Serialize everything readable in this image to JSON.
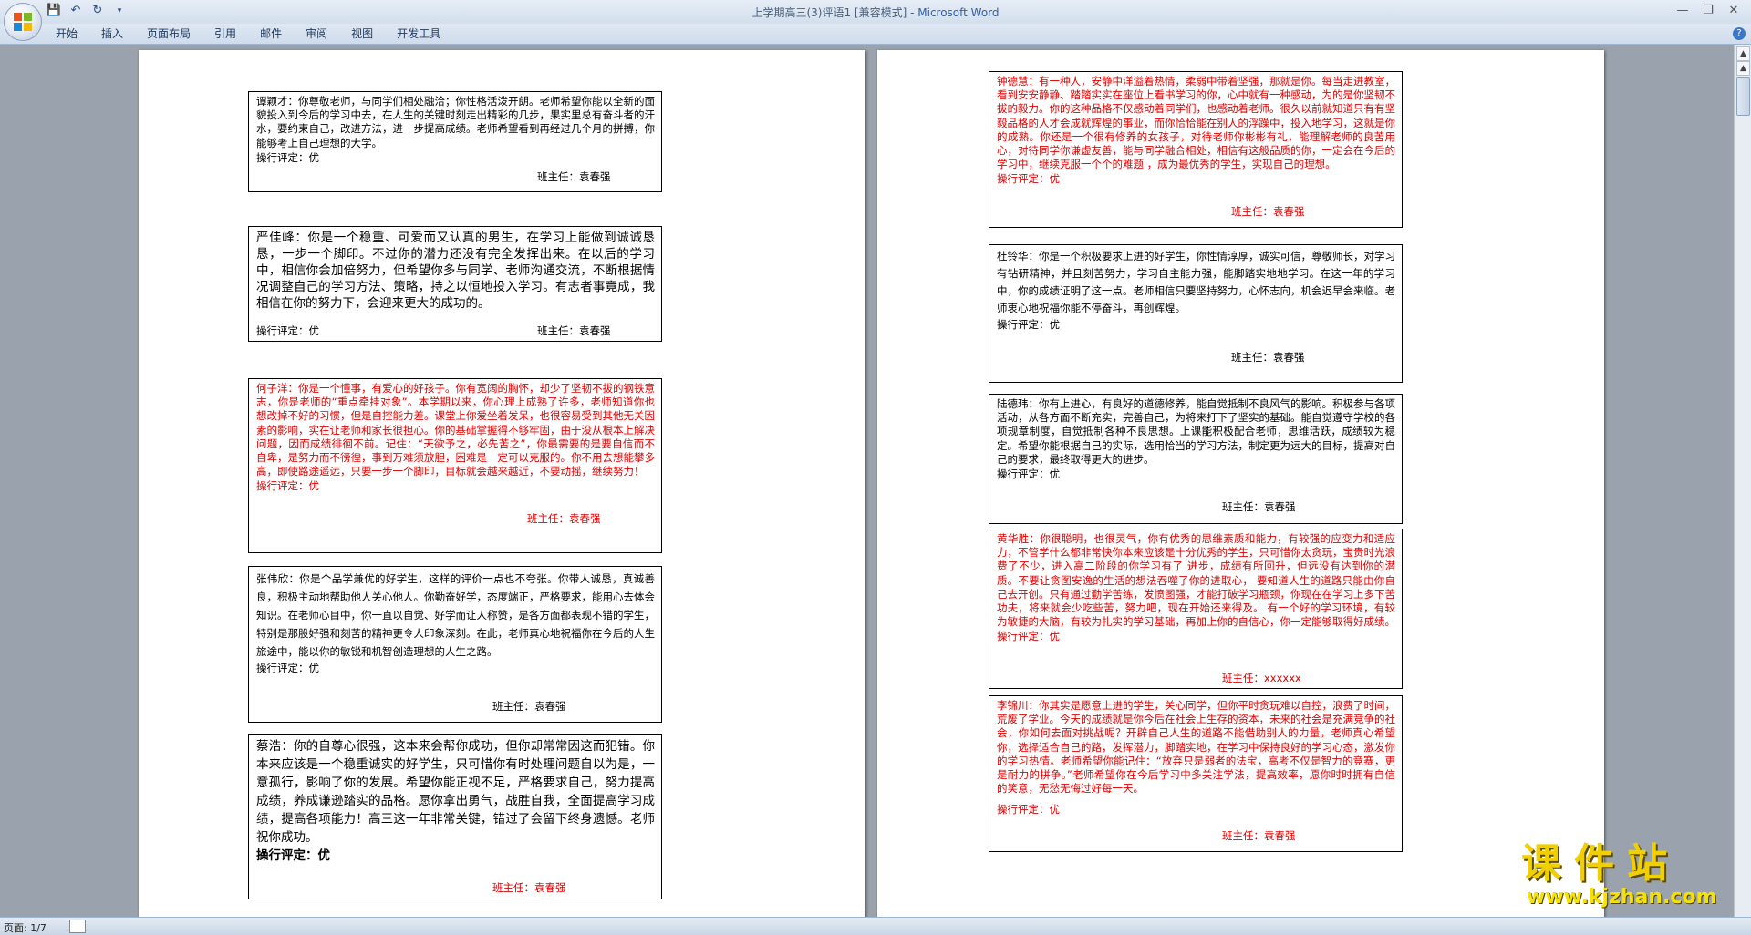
{
  "window": {
    "title": "上学期高三(3)评语1 [兼容模式]",
    "separator": " - ",
    "app": "Microsoft Word"
  },
  "ribbon": {
    "tabs": [
      "开始",
      "插入",
      "页面布局",
      "引用",
      "邮件",
      "审阅",
      "视图",
      "开发工具"
    ]
  },
  "rating_text": "操行评定：优",
  "teacher_label": "班主任：袁春强",
  "left_page": [
    {
      "name": "谭颖才",
      "text": "谭颖才：你尊敬老师，与同学们相处融洽；你性格活泼开朗。老师希望你能以全新的面貌投入到今后的学习中去，在人生的关键时刻走出精彩的几步，果实里总有奋斗者的汗水，要约束自己，改进方法，进一步提高成绩。老师希望看到再经过几个月的拼搏，你能够考上自己理想的大学。",
      "rating": "操行评定：优",
      "teacher": "班主任：袁春强",
      "color": "#000000"
    },
    {
      "name": "严佳峰",
      "text": "严佳峰：你是一个稳重、可爱而又认真的男生，在学习上能做到诚诚恳恳，一步一个脚印。不过你的潜力还没有完全发挥出来。在以后的学习中，相信你会加倍努力，但希望你多与同学、老师沟通交流，不断根据情况调整自己的学习方法、策略，持之以恒地投入学习。有志者事竟成，我相信在你的努力下，会迎来更大的成功的。",
      "rating": "操行评定：优",
      "teacher": "班主任：袁春强",
      "color": "#000000"
    },
    {
      "name": "何子洋",
      "text": "何子洋：你是一个懂事，有爱心的好孩子。你有宽阔的胸怀，却少了坚韧不拔的钢铁意志，你是老师的“重点牵挂对象”。本学期以来，你心理上成熟了许多，老师知道你也想改掉不好的习惯，但是自控能力差。课堂上你爱坐着发呆，也很容易受到其他无关因素的影响，实在让老师和家长很担心。你的基础掌握得不够牢固，由于没从根本上解决问题，因而成绩徘徊不前。记住：“天欲予之，必先苦之”，你最需要的是要自信而不自卑，是努力而不徬徨，事到万难须放胆，困难是一定可以克服的。你不用去想能攀多高，即使路途遥远，只要一步一个脚印，目标就会越来越近，不要动摇，继续努力！",
      "rating": "操行评定：优",
      "teacher": "班主任：袁春强",
      "color": "#e00000"
    },
    {
      "name": "张伟欣",
      "text": "张伟欣：你是个品学兼优的好学生，这样的评价一点也不夸张。你带人诚恳，真诚善良，积极主动地帮助他人关心他人。你勤奋好学，态度端正，严格要求，能用心去体会知识。在老师心目中，你一直以自觉、好学而让人称赞，是各方面都表现不错的学生，特别是那股好强和刻苦的精神更令人印象深刻。在此，老师真心地祝福你在今后的人生旅途中，能以你的敏锐和机智创造理想的人生之路。",
      "rating": "操行评定：优",
      "teacher": "班主任：袁春强",
      "color": "#000000"
    },
    {
      "name": "蔡浩",
      "text": "蔡浩：你的自尊心很强，这本来会帮你成功，但你却常常因这而犯错。你本来应该是一个稳重诚实的好学生，只可惜你有时处理问题自以为是，一意孤行，影响了你的发展。希望你能正视不足，严格要求自己，努力提高成绩，养成谦逊踏实的品格。愿你拿出勇气，战胜自我，全面提高学习成绩，提高各项能力！高三这一年非常关键，错过了会留下终身遗憾。老师祝你成功。",
      "rating": "操行评定：优",
      "teacher": "班主任：袁春强",
      "color": "#000000"
    }
  ],
  "right_page": [
    {
      "name": "钟德慧",
      "text": "钟德慧：有一种人，安静中洋溢着热情，柔弱中带着坚强，那就是你。每当走进教室，看到安安静静、踏踏实实在座位上看书学习的你，心中就有一种感动，为的是你坚韧不拔的毅力。你的这种品格不仅感动着同学们，也感动着老师。很久以前就知道只有有坚毅品格的人才会成就辉煌的事业，而你恰恰能在别人的浮躁中，投入地学习，这就是你的成熟。你还是一个很有修养的女孩子，对待老师你彬彬有礼，能理解老师的良苦用心，对待同学你谦虚友善，能与同学融合相处，相信有这般品质的你，一定会在今后的学习中，继续克服一个个的难题 ，成为最优秀的学生，实现自己的理想。",
      "rating": "操行评定：优",
      "teacher": "班主任：袁春强",
      "color": "#e00000"
    },
    {
      "name": "杜铃华",
      "text": "杜铃华：你是一个积极要求上进的好学生，你性情淳厚，诚实可信，尊敬师长，对学习有钻研精神，并且刻苦努力，学习自主能力强，能脚踏实地地学习。在这一年的学习中，你的成绩证明了这一点。老师相信只要坚持努力，心怀志向，机会迟早会来临。老师衷心地祝福你能不停奋斗，再创辉煌。",
      "rating": "操行评定：优",
      "teacher": "班主任：袁春强",
      "color": "#000000"
    },
    {
      "name": "陆德玮",
      "text": "陆德玮：你有上进心，有良好的道德修养，能自觉抵制不良风气的影响。积极参与各项活动，从各方面不断充实，完善自己，为将来打下了坚实的基础。能自觉遵守学校的各项规章制度，自觉抵制各种不良思想。上课能积极配合老师，思维活跃，成绩较为稳定。希望你能根据自己的实际，选用恰当的学习方法，制定更为远大的目标，提高对自己的要求，最终取得更大的进步。",
      "rating": "操行评定：优",
      "teacher": "班主任：袁春强",
      "color": "#000000"
    },
    {
      "name": "黄华胜",
      "text": "黄华胜：你很聪明，也很灵气，你有优秀的思维素质和能力，有较强的应变力和适应力，不管学什么都非常快你本来应该是十分优秀的学生，只可惜你太贪玩，宝贵时光浪费了不少，进入高二阶段的你学习有了 进步，成绩有所回升，但远没有达到你的潜质。不要让贪图安逸的生活的想法吞噬了你的进取心， 要知道人生的道路只能由你自己去开创。只有通过勤学苦练，发愤图强，才能打破学习瓶颈，你现在在学习上多下苦功夫，将来就会少吃些苦，努力吧，现在开始还来得及。 有一个好的学习环境，有较为敏捷的大脑，有较为扎实的学习基础，再加上你的自信心，你一定能够取得好成绩。",
      "rating": "操行评定：优",
      "teacher": "班主任：xxxxxx",
      "color": "#e00000"
    },
    {
      "name": "李锦川",
      "text": "李锦川：你其实是愿意上进的学生，关心同学，但你平时贪玩难以自控，浪费了时间，荒废了学业。今天的成绩就是你今后在社会上生存的资本，未来的社会是充满竞争的社会，你如何去面对挑战呢？开辟自己人生的道路不能借助别人的力量，老师真心希望你，选择适合自己的路，发挥潜力，脚踏实地，在学习中保持良好的学习心态，激发你的学习热情。老师希望你能记住：“放弃只是弱者的法宝，高考不仅是智力的竞赛，更是耐力的拼争。”老师希望你在今后学习中多关注学法，提高效率，愿你时时拥有自信的笑意，无愁无悔过好每一天。",
      "rating": "操行评定：优",
      "teacher": "班主任：袁春强",
      "color": "#e00000"
    }
  ],
  "status": {
    "page": "页面: 1/7"
  },
  "watermark": {
    "big": "课件站",
    "url": "www.kjzhan.com"
  },
  "icons": [
    "office-button-icon",
    "save-icon",
    "undo-icon",
    "redo-icon",
    "customize-qat-icon",
    "minimize-icon",
    "restore-icon",
    "close-icon",
    "help-icon",
    "paragraph-mark-icon"
  ]
}
